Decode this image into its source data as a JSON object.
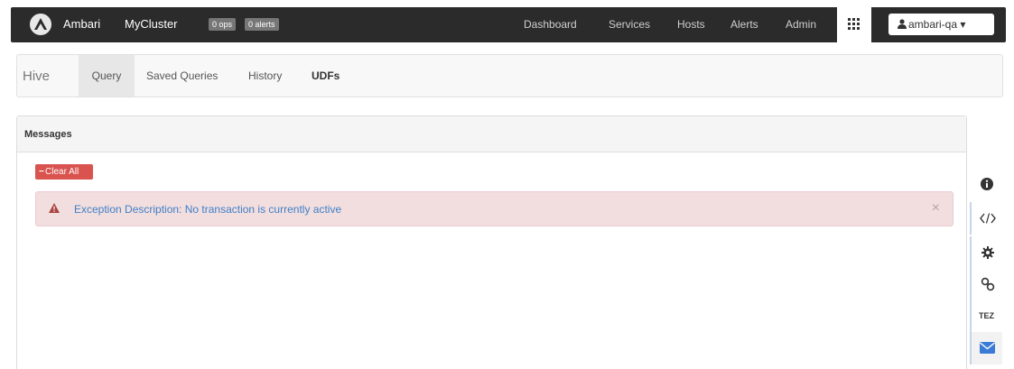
{
  "navbar": {
    "brand": "Ambari",
    "cluster": "MyCluster",
    "ops_badge": "0 ops",
    "alerts_badge": "0 alerts",
    "links": [
      "Dashboard",
      "Services",
      "Hosts",
      "Alerts",
      "Admin"
    ],
    "user": "ambari-qa",
    "bg_color": "#2b2b2b"
  },
  "hive_nav": {
    "title": "Hive",
    "tabs": [
      "Query",
      "Saved Queries",
      "History",
      "UDFs"
    ],
    "active_tab": "Query"
  },
  "messages": {
    "title": "Messages",
    "clear_label": "Clear All",
    "alert_text": "Exception Description: No transaction is currently active",
    "close_symbol": "×",
    "alert_bg": "#f2dede",
    "danger_color": "#d9534f"
  },
  "sidebar": {
    "items": [
      "info-icon",
      "code-icon",
      "gear-icon",
      "link-icon",
      "TEZ",
      "envelope-icon"
    ],
    "tez_label": "TEZ"
  }
}
